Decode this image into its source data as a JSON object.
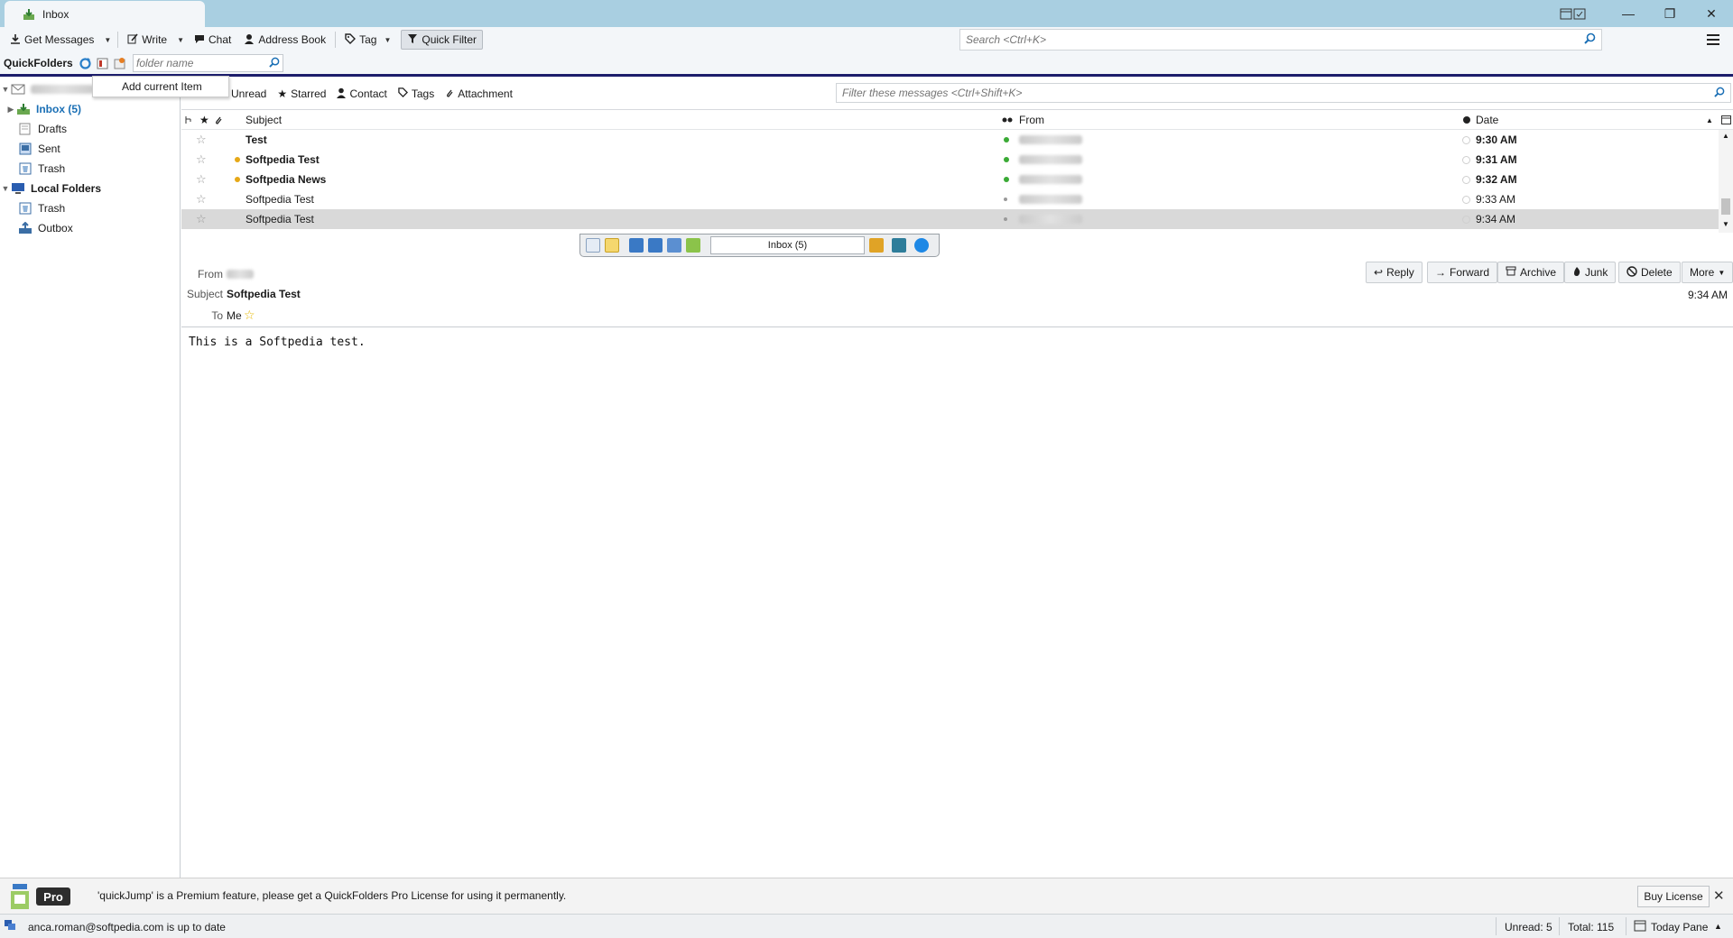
{
  "window": {
    "tab_label": "Inbox",
    "minimize_glyph": "—",
    "maximize_glyph": "❐",
    "close_glyph": "✕"
  },
  "toolbar": {
    "get_messages": "Get Messages",
    "write": "Write",
    "chat": "Chat",
    "address_book": "Address Book",
    "tag": "Tag",
    "quick_filter": "Quick Filter",
    "search_placeholder": "Search <Ctrl+K>"
  },
  "quickfolders": {
    "label": "QuickFolders",
    "search_placeholder": "folder name",
    "popup_item": "Add current Item"
  },
  "folders": {
    "inbox": "Inbox (5)",
    "drafts": "Drafts",
    "sent": "Sent",
    "trash": "Trash",
    "local_folders": "Local Folders",
    "local_trash": "Trash",
    "outbox": "Outbox"
  },
  "quick_filter_bar": {
    "unread": "Unread",
    "starred": "Starred",
    "contact": "Contact",
    "tags": "Tags",
    "attachment": "Attachment",
    "filter_placeholder": "Filter these messages <Ctrl+Shift+K>"
  },
  "columns": {
    "subject": "Subject",
    "from": "From",
    "date": "Date"
  },
  "messages": [
    {
      "subject": "Test",
      "date": "9:30 AM",
      "unread": true,
      "flag_dot": false,
      "status_color": "#3aaa35"
    },
    {
      "subject": "Softpedia Test",
      "date": "9:31 AM",
      "unread": true,
      "flag_dot": true,
      "status_color": "#3aaa35"
    },
    {
      "subject": "Softpedia News",
      "date": "9:32 AM",
      "unread": true,
      "flag_dot": true,
      "status_color": "#3aaa35"
    },
    {
      "subject": "Softpedia Test",
      "date": "9:33 AM",
      "unread": false,
      "flag_dot": false,
      "status_color": "#9a9a9a"
    },
    {
      "subject": "Softpedia Test",
      "date": "9:34 AM",
      "unread": false,
      "flag_dot": false,
      "status_color": "#9a9a9a"
    }
  ],
  "qf_nav": {
    "current_folder": "Inbox (5)"
  },
  "message_header": {
    "from_label": "From",
    "subject_label": "Subject",
    "subject_value": "Softpedia Test",
    "to_label": "To",
    "to_value": "Me",
    "time": "9:34 AM",
    "reply": "Reply",
    "forward": "Forward",
    "archive": "Archive",
    "junk": "Junk",
    "delete": "Delete",
    "more": "More"
  },
  "message_body": "This is a Softpedia test.",
  "notification": {
    "badge": "Pro",
    "text": "'quickJump' is a Premium feature, please get a QuickFolders Pro License for using it permanently.",
    "buy": "Buy License"
  },
  "status_bar": {
    "account_status": "anca.roman@softpedia.com is up to date",
    "unread": "Unread: 5",
    "total": "Total: 115",
    "today_pane": "Today Pane"
  },
  "colors": {
    "titlebar": "#a9cfe1",
    "accent_blue": "#1a6fb5",
    "qf_line": "#1c1d6b"
  }
}
